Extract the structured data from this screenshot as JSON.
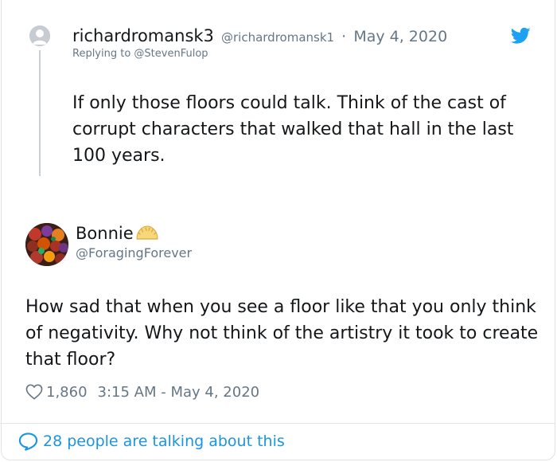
{
  "parent_tweet": {
    "display_name": "richardromansk3",
    "handle": "@richardromansk1",
    "separator": "·",
    "date": "May 4, 2020",
    "replying_to": "Replying to @StevenFulop",
    "text": "If only those floors could talk.  Think of the cast of corrupt characters that walked that hall in the last 100 years."
  },
  "main_tweet": {
    "display_name": "Bonnie",
    "handle": "@ForagingForever",
    "text": "How sad that when you see a floor like that you only think of negativity. Why not think of the artistry it took to create that floor?",
    "likes": "1,860",
    "timestamp": "3:15 AM - May 4, 2020"
  },
  "footer": {
    "talking_text": "28 people are talking about this"
  },
  "colors": {
    "link_blue": "#1b95e0",
    "secondary_text": "#657786",
    "primary_text": "#14171a",
    "twitter_blue": "#1da1f2"
  },
  "icons": [
    "default-avatar-icon",
    "twitter-bird-icon",
    "pierogi-emoji-icon",
    "heart-icon",
    "speech-bubble-icon"
  ]
}
